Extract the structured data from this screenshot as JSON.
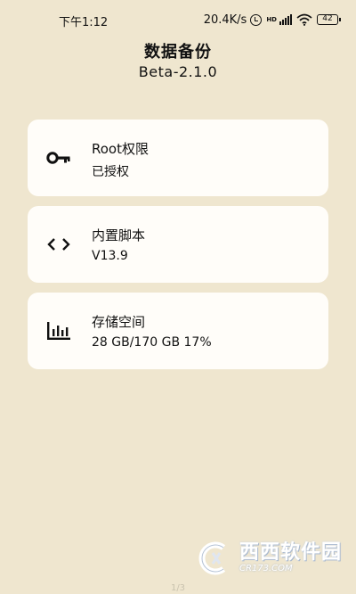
{
  "statusbar": {
    "time": "下午1:12",
    "network_speed": "20.4K/s",
    "hd_label": "HD",
    "battery": "42"
  },
  "header": {
    "title": "数据备份",
    "version": "Beta-2.1.0"
  },
  "cards": [
    {
      "icon": "key-icon",
      "title": "Root权限",
      "subtitle": "已授权"
    },
    {
      "icon": "code-icon",
      "title": "内置脚本",
      "subtitle": "V13.9"
    },
    {
      "icon": "bar-chart-icon",
      "title": "存储空间",
      "subtitle": "28 GB/170 GB 17%"
    }
  ],
  "watermark": {
    "text": "西西软件园",
    "site": "CR173.COM"
  },
  "footer": {
    "page_indicator": "1/3"
  }
}
